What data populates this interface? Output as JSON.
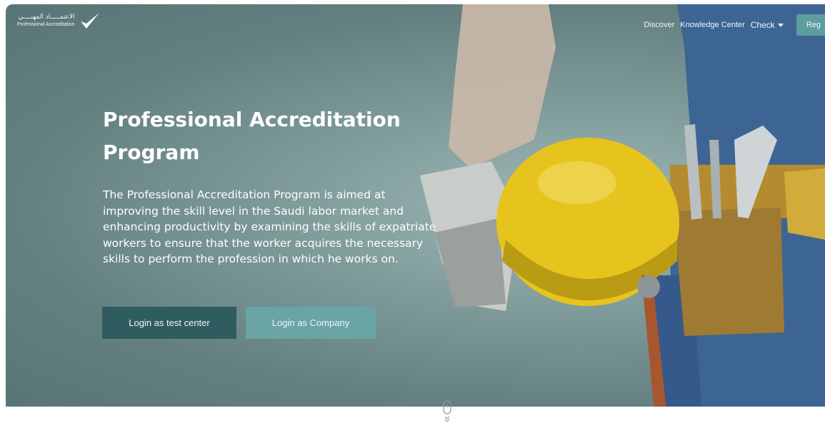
{
  "header": {
    "logo_arabic": "الاعتمـــــاد المهنــــي",
    "logo_english": "Professional Accreditation",
    "nav": {
      "discover": "Discover",
      "knowledge_center": "Knowledge Center",
      "check": "Check",
      "register": "Reg"
    }
  },
  "hero": {
    "title": "Professional Accreditation Program",
    "description": "The Professional Accreditation Program is aimed at improving the skill level in the Saudi labor market and enhancing productivity by examining the skills of expatriate workers to ensure that the worker acquires the necessary skills to perform the profession in which he works on.",
    "buttons": {
      "test_center": "Login as test center",
      "company": "Login as Company"
    }
  },
  "icons": {
    "logo": "checkmark-icon",
    "scroll": "mouse-scroll-icon",
    "dropdown": "caret-down-icon"
  },
  "colors": {
    "hero_bg": "#6f8d8d",
    "primary_button": "#2f5d5f",
    "secondary_button": "#6aa4a5",
    "helmet": "#e6c41d"
  }
}
